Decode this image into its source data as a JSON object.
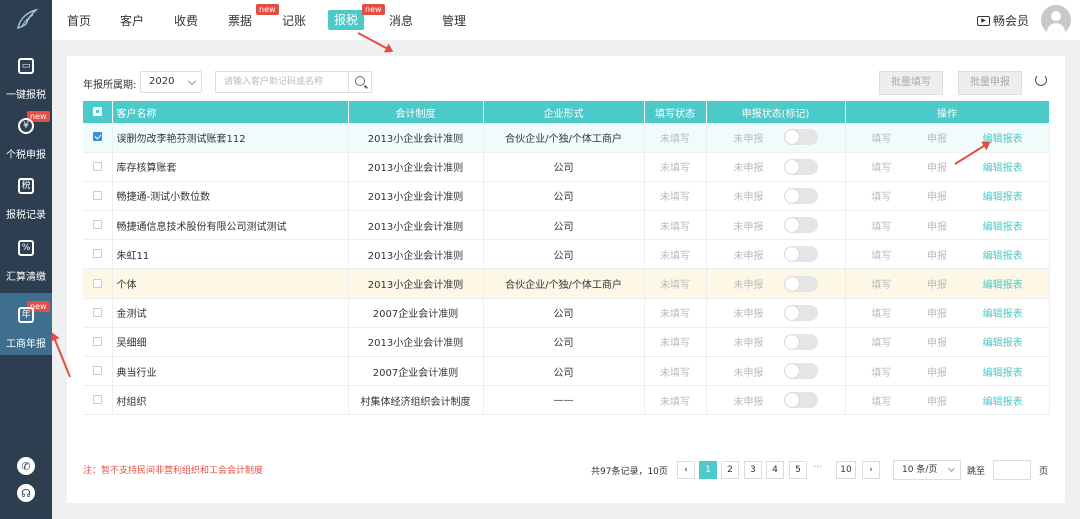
{
  "sidebar": {
    "items": [
      {
        "label": "一键报税",
        "icon": "monitor-icon",
        "badge": ""
      },
      {
        "label": "个税申报",
        "icon": "person-tax-icon",
        "badge": "new"
      },
      {
        "label": "报税记录",
        "icon": "tax-record-icon",
        "badge": ""
      },
      {
        "label": "汇算清缴",
        "icon": "calculator-icon",
        "badge": ""
      },
      {
        "label": "工商年报",
        "icon": "calendar-year-icon",
        "badge": "new"
      }
    ],
    "bottom_icons": [
      "phone-icon",
      "headset-icon"
    ]
  },
  "topnav": {
    "items": [
      {
        "label": "首页",
        "badge": ""
      },
      {
        "label": "客户",
        "badge": ""
      },
      {
        "label": "收费",
        "badge": ""
      },
      {
        "label": "票据",
        "badge": "new"
      },
      {
        "label": "记账",
        "badge": ""
      },
      {
        "label": "报税",
        "badge": "new"
      },
      {
        "label": "消息",
        "badge": ""
      },
      {
        "label": "管理",
        "badge": ""
      }
    ],
    "active": "报税",
    "vip_label": "畅会员"
  },
  "filters": {
    "year_label": "年报所属期:",
    "year_value": "2020",
    "search_placeholder": "请输入客户助记码或名称",
    "batch_fill": "批量填写",
    "batch_declare": "批量申报"
  },
  "table": {
    "headers": [
      "客户名称",
      "会计制度",
      "企业形式",
      "填写状态",
      "申报状态(标记)",
      "操作"
    ],
    "rows": [
      {
        "name": "误删勿改李艳芬测试账套112",
        "system": "2013小企业会计准则",
        "form": "合伙企业/个独/个体工商户",
        "fill": "未填写",
        "declare": "未申报",
        "op1": "填写",
        "op2": "申报",
        "op3": "编辑报表",
        "checked": true
      },
      {
        "name": "库存核算账套",
        "system": "2013小企业会计准则",
        "form": "公司",
        "fill": "未填写",
        "declare": "未申报",
        "op1": "填写",
        "op2": "申报",
        "op3": "编辑报表",
        "checked": false
      },
      {
        "name": "畅捷通-测试小数位数",
        "system": "2013小企业会计准则",
        "form": "公司",
        "fill": "未填写",
        "declare": "未申报",
        "op1": "填写",
        "op2": "申报",
        "op3": "编辑报表",
        "checked": false
      },
      {
        "name": "畅捷通信息技术股份有限公司测试测试",
        "system": "2013小企业会计准则",
        "form": "公司",
        "fill": "未填写",
        "declare": "未申报",
        "op1": "填写",
        "op2": "申报",
        "op3": "编辑报表",
        "checked": false
      },
      {
        "name": "朱虹11",
        "system": "2013小企业会计准则",
        "form": "公司",
        "fill": "未填写",
        "declare": "未申报",
        "op1": "填写",
        "op2": "申报",
        "op3": "编辑报表",
        "checked": false
      },
      {
        "name": "个体",
        "system": "2013小企业会计准则",
        "form": "合伙企业/个独/个体工商户",
        "fill": "未填写",
        "declare": "未申报",
        "op1": "填写",
        "op2": "申报",
        "op3": "编辑报表",
        "checked": false
      },
      {
        "name": "金测试",
        "system": "2007企业会计准则",
        "form": "公司",
        "fill": "未填写",
        "declare": "未申报",
        "op1": "填写",
        "op2": "申报",
        "op3": "编辑报表",
        "checked": false
      },
      {
        "name": "吴细细",
        "system": "2013小企业会计准则",
        "form": "公司",
        "fill": "未填写",
        "declare": "未申报",
        "op1": "填写",
        "op2": "申报",
        "op3": "编辑报表",
        "checked": false
      },
      {
        "name": "典当行业",
        "system": "2007企业会计准则",
        "form": "公司",
        "fill": "未填写",
        "declare": "未申报",
        "op1": "填写",
        "op2": "申报",
        "op3": "编辑报表",
        "checked": false
      },
      {
        "name": "村组织",
        "system": "村集体经济组织会计制度",
        "form": "——",
        "fill": "未填写",
        "declare": "未申报",
        "op1": "填写",
        "op2": "申报",
        "op3": "编辑报表",
        "checked": false
      }
    ]
  },
  "footer": {
    "note": "注：暂不支持民间非营利组织和工会会计制度",
    "total": "共97条记录，10页",
    "pages": [
      "1",
      "2",
      "3",
      "4",
      "5"
    ],
    "dots": "···",
    "last_page": "10",
    "current_page": "1",
    "per_page": "10 条/页",
    "jump_label": "跳至",
    "page_unit": "页"
  },
  "colors": {
    "accent": "#4ccac9",
    "sidebar": "#2c3e50",
    "badge": "#e54d42",
    "note": "#e54d42"
  }
}
